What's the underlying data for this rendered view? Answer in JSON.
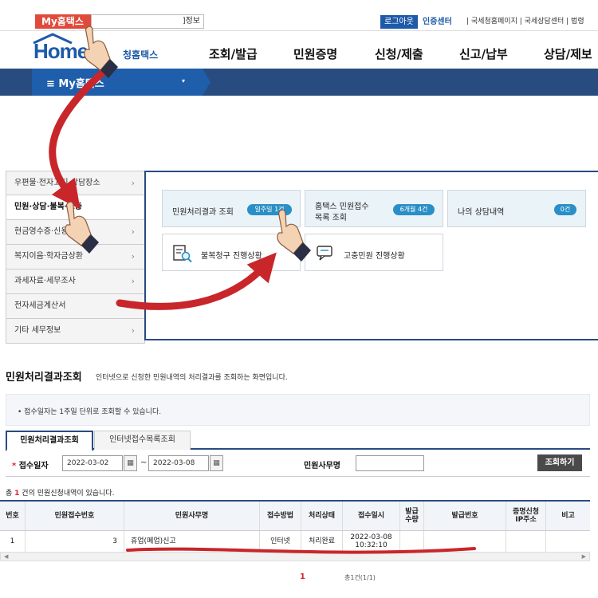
{
  "topbar": {
    "my_label": "My홈택스",
    "user_box": "]정보",
    "logout": "로그아웃",
    "cert_center": "인증센터",
    "links": "| 국세청홈페이지 | 국세상담센터 | 법령"
  },
  "gnb": {
    "logo_text": "Home",
    "logo_sub": "청홈택스",
    "menu": [
      "조회/발급",
      "민원증명",
      "신청/제출",
      "신고/납부",
      "상담/제보"
    ]
  },
  "bluebar": {
    "label": "≡  My홈택스",
    "caret": "▾"
  },
  "side_menu": [
    {
      "label": "우편물·전자고지·상담장소",
      "arrow": "›"
    },
    {
      "label": "민원·상담·불복·고충",
      "arrow": ""
    },
    {
      "label": "현금영수증·신용카드",
      "arrow": "›"
    },
    {
      "label": "복지이음·학자금상환",
      "arrow": "›"
    },
    {
      "label": "과세자료·세무조사",
      "arrow": "›"
    },
    {
      "label": "전자세금계산서",
      "arrow": "›"
    },
    {
      "label": "기타 세무정보",
      "arrow": "›"
    }
  ],
  "cards": {
    "result": {
      "label": "민원처리결과 조회",
      "pill": "일주일 1건"
    },
    "hometax": {
      "label_1": "홈택스 민원접수",
      "label_2": "목록 조회",
      "pill": "6개월 4건"
    },
    "consult": {
      "label": "나의 상담내역",
      "pill": "0건"
    },
    "appeal": {
      "label": "불복청구 진행상황"
    },
    "grievance": {
      "label": "고충민원 진행상황"
    }
  },
  "page": {
    "title": "민원처리결과조회",
    "desc": "인터넷으로 신청한 민원내역의 처리결과를 조회하는 화면입니다.",
    "notice": "• 접수일자는 1주일 단위로 조회할 수 있습니다."
  },
  "tabs": [
    "민원처리결과조회",
    "인터넷접수목록조회"
  ],
  "search": {
    "date_label": "접수일자",
    "star": "*",
    "date_from": "2022-03-02",
    "date_to": "2022-03-08",
    "tilde": "~",
    "cal": "▦",
    "name_label": "민원사무명",
    "button": "조회하기"
  },
  "count": {
    "prefix": "총 ",
    "num": "1",
    "suffix": " 건의 민원신청내역이 있습니다."
  },
  "table": {
    "headers": [
      "번호",
      "민원접수번호",
      "민원사무명",
      "접수방법",
      "처리상태",
      "접수일시",
      "발급\n수량",
      "발급번호",
      "증명신청\nIP주소",
      "비고"
    ],
    "row": {
      "no": "1",
      "receipt_no": "3",
      "name": "휴업(폐업)신고",
      "method": "인터넷",
      "status": "처리완료",
      "datetime_1": "2022-03-08",
      "datetime_2": "10:32:10",
      "qty": "",
      "issue_no": "",
      "ip": "",
      "note": ""
    }
  },
  "pager": {
    "current": "1",
    "total": "총1건(1/1)"
  },
  "colors": {
    "navy": "#284c7f",
    "blue": "#1e5eab",
    "red": "#e04a3a",
    "pill": "#2a8fc6",
    "annotation": "#c8262b"
  }
}
